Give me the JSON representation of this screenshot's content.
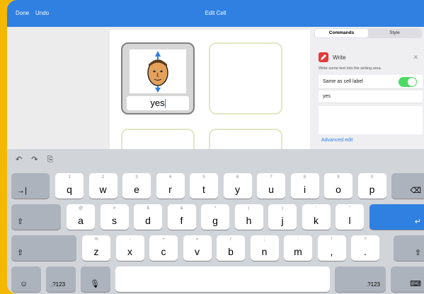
{
  "navbar": {
    "done": "Done",
    "undo": "Undo",
    "title": "Edit Cell"
  },
  "cell": {
    "label": "yes"
  },
  "panel": {
    "tabs": [
      "Commands",
      "Style"
    ],
    "write_title": "Write",
    "write_desc": "Write some text into the writing area.",
    "toggle_label": "Same as cell label",
    "toggle_on": true,
    "text_value": "yes",
    "advanced_link": "Advanced edit"
  },
  "keyboard": {
    "tools": [
      "↶",
      "↷",
      "⎘"
    ],
    "row1": [
      {
        "h": "1",
        "k": "q"
      },
      {
        "h": "2",
        "k": "w"
      },
      {
        "h": "3",
        "k": "e"
      },
      {
        "h": "4",
        "k": "r"
      },
      {
        "h": "5",
        "k": "t"
      },
      {
        "h": "6",
        "k": "y"
      },
      {
        "h": "7",
        "k": "u"
      },
      {
        "h": "8",
        "k": "i"
      },
      {
        "h": "9",
        "k": "o"
      },
      {
        "h": "0",
        "k": "p"
      }
    ],
    "row2": [
      {
        "h": "@",
        "k": "a"
      },
      {
        "h": "#",
        "k": "s"
      },
      {
        "h": "$",
        "k": "d"
      },
      {
        "h": "&",
        "k": "f"
      },
      {
        "h": "*",
        "k": "g"
      },
      {
        "h": "(",
        "k": "h"
      },
      {
        "h": ")",
        "k": "j"
      },
      {
        "h": "'",
        "k": "k"
      },
      {
        "h": "\"",
        "k": "l"
      }
    ],
    "row3": [
      {
        "h": "%",
        "k": "z"
      },
      {
        "h": "-",
        "k": "x"
      },
      {
        "h": "+",
        "k": "c"
      },
      {
        "h": "=",
        "k": "v"
      },
      {
        "h": "/",
        "k": "b"
      },
      {
        "h": ";",
        "k": "n"
      },
      {
        "h": ":",
        "k": "m"
      },
      {
        "h": "!",
        "k": ","
      },
      {
        "h": "?",
        "k": "."
      }
    ],
    "tab_icon": "→|",
    "delete_icon": "⌫",
    "shift_icon": "⇧",
    "return_icon": "↵",
    "emoji_icon": "☺",
    "num_label": ".?123",
    "mic_icon": "🎙",
    "hide_icon": "⌨"
  }
}
